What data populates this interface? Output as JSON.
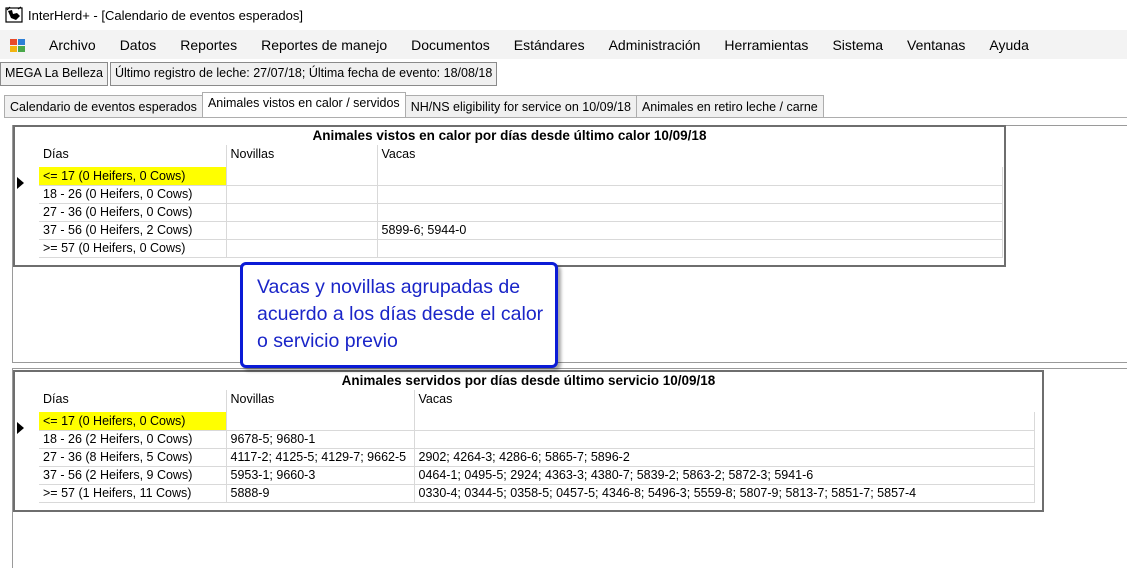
{
  "window": {
    "title": "InterHerd+ - [Calendario de eventos esperados]",
    "app_icon": "cow-app-icon"
  },
  "menubar": {
    "items": [
      "Archivo",
      "Datos",
      "Reportes",
      "Reportes de manejo",
      "Documentos",
      "Estándares",
      "Administración",
      "Herramientas",
      "Sistema",
      "Ventanas",
      "Ayuda"
    ]
  },
  "status": {
    "herd": "MEGA La Belleza",
    "last_records": "Último registro de leche: 27/07/18; Última fecha de evento: 18/08/18"
  },
  "tabs": [
    {
      "label": "Calendario de eventos esperados",
      "active": false
    },
    {
      "label": "Animales vistos en calor / servidos",
      "active": true
    },
    {
      "label": "NH/NS eligibility for service on 10/09/18",
      "active": false
    },
    {
      "label": "Animales en retiro leche / carne",
      "active": false
    }
  ],
  "heat_grid": {
    "title": "Animales vistos en calor por días desde último calor 10/09/18",
    "columns": [
      "Días",
      "Novillas",
      "Vacas"
    ],
    "rows": [
      {
        "dias": "<= 17 (0 Heifers, 0 Cows)",
        "novillas": "",
        "vacas": ""
      },
      {
        "dias": "18 - 26 (0 Heifers, 0 Cows)",
        "novillas": "",
        "vacas": ""
      },
      {
        "dias": "27 - 36 (0 Heifers, 0 Cows)",
        "novillas": "",
        "vacas": ""
      },
      {
        "dias": "37 - 56 (0 Heifers, 2 Cows)",
        "novillas": "",
        "vacas": "5899-6; 5944-0"
      },
      {
        "dias": ">= 57 (0 Heifers, 0 Cows)",
        "novillas": "",
        "vacas": ""
      }
    ]
  },
  "service_grid": {
    "title": "Animales servidos por días desde último servicio 10/09/18",
    "columns": [
      "Días",
      "Novillas",
      "Vacas"
    ],
    "rows": [
      {
        "dias": "<= 17 (0 Heifers, 0 Cows)",
        "novillas": "",
        "vacas": ""
      },
      {
        "dias": "18 - 26 (2 Heifers, 0 Cows)",
        "novillas": "9678-5; 9680-1",
        "vacas": ""
      },
      {
        "dias": "27 - 36 (8 Heifers, 5 Cows)",
        "novillas": "4117-2; 4125-5; 4129-7; 9662-5",
        "vacas": "2902; 4264-3; 4286-6; 5865-7; 5896-2"
      },
      {
        "dias": "37 - 56 (2 Heifers, 9 Cows)",
        "novillas": "5953-1; 9660-3",
        "vacas": "0464-1; 0495-5; 2924; 4363-3; 4380-7; 5839-2; 5863-2; 5872-3; 5941-6"
      },
      {
        "dias": ">= 57 (1 Heifers, 11 Cows)",
        "novillas": "5888-9",
        "vacas": "0330-4; 0344-5; 0358-5; 0457-5; 4346-8; 5496-3; 5559-8; 5807-9; 5813-7; 5851-7; 5857-4"
      }
    ]
  },
  "callout": {
    "text": "Vacas y novillas agrupadas de acuerdo a los días desde el calor o servicio previo"
  },
  "colors": {
    "selected_row": "#ffff00",
    "callout_border": "#0b1bd6",
    "callout_text": "#1a25c8"
  }
}
